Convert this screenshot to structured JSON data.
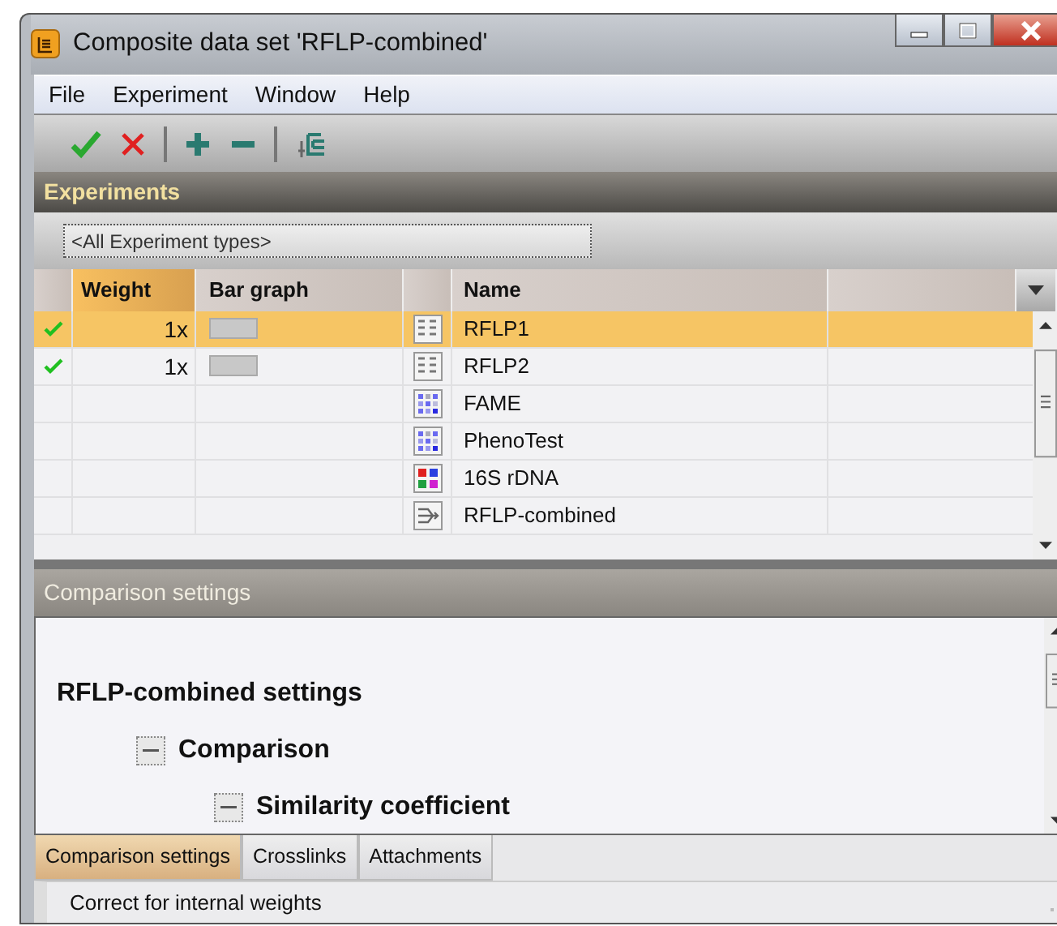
{
  "window": {
    "title": "Composite data set 'RFLP-combined'"
  },
  "menu": [
    "File",
    "Experiment",
    "Window",
    "Help"
  ],
  "toolbar": [
    {
      "kind": "accept"
    },
    {
      "kind": "reject"
    },
    {
      "kind": "sep"
    },
    {
      "kind": "add"
    },
    {
      "kind": "remove"
    },
    {
      "kind": "sep"
    },
    {
      "kind": "tree"
    }
  ],
  "experiments": {
    "title": "Experiments",
    "filter": "<All Experiment types>",
    "columns": [
      {
        "label": "Weight",
        "selected": true
      },
      {
        "label": "Bar graph",
        "selected": false
      },
      {
        "label": "Name",
        "selected": false
      }
    ],
    "rows": [
      {
        "checked": true,
        "weight": "1x",
        "bar": true,
        "kind": "bands",
        "name": "RFLP1",
        "selected": true
      },
      {
        "checked": true,
        "weight": "1x",
        "bar": true,
        "kind": "bands",
        "name": "RFLP2",
        "selected": false
      },
      {
        "checked": false,
        "kind": "matrix",
        "name": "FAME",
        "selected": false
      },
      {
        "checked": false,
        "kind": "matrix",
        "name": "PhenoTest",
        "selected": false
      },
      {
        "checked": false,
        "kind": "sequence",
        "name": "16S rDNA",
        "selected": false
      },
      {
        "checked": false,
        "kind": "composite",
        "name": "RFLP-combined",
        "selected": false
      }
    ]
  },
  "comparison": {
    "title": "Comparison settings",
    "tree": {
      "label": "RFLP-combined settings",
      "children": [
        {
          "label": "Comparison",
          "expanded": true,
          "children": [
            {
              "label": "Similarity coefficient",
              "expanded": true
            }
          ]
        }
      ]
    }
  },
  "tabs": [
    {
      "label": "Comparison settings",
      "selected": true
    },
    {
      "label": "Crosslinks",
      "selected": false
    },
    {
      "label": "Attachments",
      "selected": false
    }
  ],
  "status_bar": "Correct for internal weights"
}
